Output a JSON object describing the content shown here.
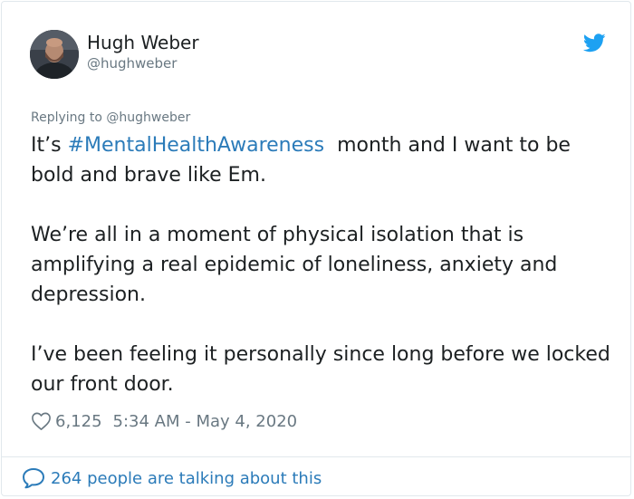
{
  "author": {
    "name": "Hugh Weber",
    "handle": "@hughweber",
    "avatar": "person-photo-avatar"
  },
  "platform": {
    "icon": "twitter-bird-icon",
    "color": "#1da1f2"
  },
  "reply": {
    "text": "Replying to @hughweber"
  },
  "tweet": {
    "p1_pre": "It’s",
    "hashtag": "#MentalHealthAwareness",
    "p1_post": "month and I want to be bold and brave like Em.",
    "p2": "We’re all in a moment of physical isolation that is amplifying a real epidemic of loneliness, anxiety and depression.",
    "p3": "I’ve been feeling it personally since long before we locked our front door."
  },
  "meta": {
    "like_icon": "heart-icon",
    "likes": "6,125",
    "timestamp": "5:34 AM - May 4, 2020"
  },
  "footer": {
    "icon": "speech-bubble-icon",
    "talking": "264 people are talking about this"
  },
  "colors": {
    "text": "#1c2022",
    "muted": "#697882",
    "link": "#2b7bb9",
    "border": "#e1e8ed"
  }
}
